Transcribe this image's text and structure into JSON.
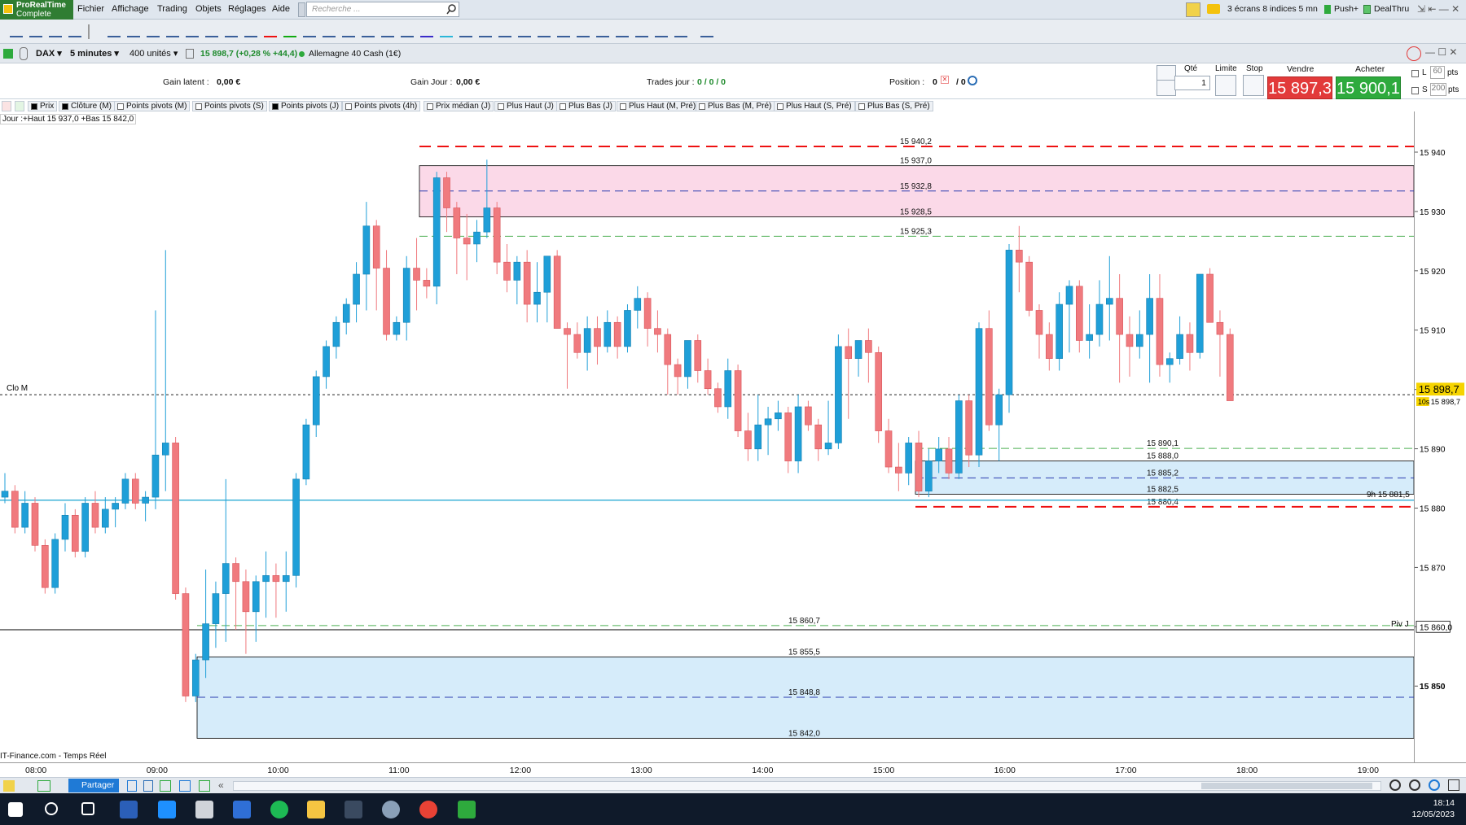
{
  "app": {
    "brand": "ProRealTime",
    "edition": "Complete"
  },
  "menu": [
    "Fichier",
    "Affichage",
    "Trading",
    "Objets",
    "Réglages",
    "Aide"
  ],
  "search": {
    "placeholder": "Recherche ..."
  },
  "topright": {
    "layout": "3 écrans 8 indices 5 mn",
    "push": "Push+",
    "dealthru": "DealThru"
  },
  "instrument": {
    "name": "DAX",
    "timeframe": "5 minutes",
    "units": "400 unités",
    "quote": "15 898,7 (+0,28 % +44,4)",
    "market": "Allemagne 40 Cash (1€)"
  },
  "order": {
    "gain_latent_label": "Gain latent :",
    "gain_latent": "0,00 €",
    "gain_jour_label": "Gain Jour :",
    "gain_jour": "0,00 €",
    "trades_label": "Trades jour :",
    "trades": "0 / 0 / 0",
    "position_label": "Position :",
    "position": "0",
    "position2": "/ 0",
    "qty_label": "Qté",
    "qty": "1",
    "limit_label": "Limite",
    "stop_label": "Stop",
    "sell_label": "Vendre",
    "sell_price": "15 897,3",
    "buy_label": "Acheter",
    "buy_price": "15 900,1",
    "l_label": "L",
    "l_value": "60",
    "s_label": "S",
    "s_value": "200",
    "pts": "pts"
  },
  "legend": [
    {
      "label": "Prix",
      "on": true
    },
    {
      "label": "Clôture (M)",
      "on": true
    },
    {
      "label": "Points pivots (M)",
      "on": false
    },
    {
      "label": "Points pivots (S)",
      "on": false
    },
    {
      "label": "Points pivots (J)",
      "on": true
    },
    {
      "label": "Points pivots (4h)",
      "on": false
    },
    {
      "label": "Prix médian (J)",
      "on": false
    },
    {
      "label": "Plus Haut (J)",
      "on": false
    },
    {
      "label": "Plus Bas (J)",
      "on": false
    },
    {
      "label": "Plus Haut (M, Pré)",
      "on": false
    },
    {
      "label": "Plus Bas (M, Pré)",
      "on": false
    },
    {
      "label": "Plus Haut (S, Pré)",
      "on": false
    },
    {
      "label": "Plus Bas (S, Pré)",
      "on": false
    }
  ],
  "chart_info": "Jour :+Haut 15 937,0 +Bas 15 842,0",
  "source": "IT-Finance.com - Temps Réel",
  "chart_data": {
    "type": "candlestick",
    "ylim": [
      15838,
      15946
    ],
    "yticks": [
      "15 940",
      "15 930",
      "15 920",
      "15 910",
      "15 900",
      "15 890",
      "15 880",
      "15 870",
      "15 860,0",
      "15 850"
    ],
    "ytick_values": [
      15940,
      15930,
      15920,
      15910,
      15900,
      15890,
      15880,
      15870,
      15860,
      15850
    ],
    "xticks": [
      "08:00",
      "09:00",
      "10:00",
      "11:00",
      "12:00",
      "13:00",
      "14:00",
      "15:00",
      "16:00",
      "17:00",
      "18:00",
      "19:00"
    ],
    "last_price": "15 898,7",
    "last_price_value": 15898.7,
    "level_labels": {
      "clo_m": "Clo M",
      "piv_j": "Piv J",
      "r9h": "9h 15 881,5",
      "countdown": "10s",
      "last_small": "15 898,7"
    },
    "levels": [
      {
        "value": 15940.2,
        "label": "15 940,2",
        "style": "red-dash"
      },
      {
        "value": 15937.0,
        "label": "15 937,0",
        "style": "zone-edge"
      },
      {
        "value": 15932.8,
        "label": "15 932,8",
        "style": "blue-dash"
      },
      {
        "value": 15928.5,
        "label": "15 928,5",
        "style": "zone-edge"
      },
      {
        "value": 15925.3,
        "label": "15 925,3",
        "style": "green-dash"
      },
      {
        "value": 15890.1,
        "label": "15 890,1",
        "style": "green-dash"
      },
      {
        "value": 15888.0,
        "label": "15 888,0",
        "style": "zone-edge"
      },
      {
        "value": 15885.2,
        "label": "15 885,2",
        "style": "blue-dash"
      },
      {
        "value": 15882.5,
        "label": "15 882,5",
        "style": "zone-edge"
      },
      {
        "value": 15880.4,
        "label": "15 880,4",
        "style": "red-dash"
      },
      {
        "value": 15860.7,
        "label": "15 860,7",
        "style": "green-dash"
      },
      {
        "value": 15855.5,
        "label": "15 855,5",
        "style": "zone-edge"
      },
      {
        "value": 15848.8,
        "label": "15 848,8",
        "style": "blue-dash"
      },
      {
        "value": 15842.0,
        "label": "15 842,0",
        "style": "zone-edge"
      }
    ],
    "reference_lines": [
      {
        "name": "Clo M",
        "value": 15899.0
      },
      {
        "name": "Piv J",
        "value": 15860.0
      },
      {
        "name": "9h",
        "value": 15881.5
      }
    ],
    "candles": [
      [
        15882,
        15886,
        15881,
        15883
      ],
      [
        15883,
        15884,
        15876,
        15877
      ],
      [
        15877,
        15883,
        15876,
        15881
      ],
      [
        15881,
        15882,
        15873,
        15874
      ],
      [
        15874,
        15875,
        15866,
        15867
      ],
      [
        15867,
        15876,
        15866,
        15875
      ],
      [
        15875,
        15881,
        15873,
        15879
      ],
      [
        15879,
        15880,
        15872,
        15873
      ],
      [
        15873,
        15882,
        15872,
        15881
      ],
      [
        15881,
        15883,
        15876,
        15877
      ],
      [
        15877,
        15882,
        15876,
        15880
      ],
      [
        15880,
        15882,
        15877,
        15881
      ],
      [
        15881,
        15886,
        15880,
        15885
      ],
      [
        15885,
        15886,
        15880,
        15881
      ],
      [
        15881,
        15883,
        15878,
        15882
      ],
      [
        15882,
        15913,
        15880,
        15889
      ],
      [
        15889,
        15923,
        15883,
        15891
      ],
      [
        15891,
        15892,
        15865,
        15866
      ],
      [
        15866,
        15867,
        15848,
        15849
      ],
      [
        15849,
        15856,
        15848,
        15855
      ],
      [
        15855,
        15870,
        15852,
        15861
      ],
      [
        15861,
        15868,
        15857,
        15866
      ],
      [
        15866,
        15885,
        15858,
        15871
      ],
      [
        15871,
        15872,
        15860,
        15868
      ],
      [
        15868,
        15870,
        15856,
        15863
      ],
      [
        15863,
        15869,
        15858,
        15868
      ],
      [
        15868,
        15873,
        15862,
        15869
      ],
      [
        15869,
        15871,
        15862,
        15868
      ],
      [
        15868,
        15873,
        15863,
        15869
      ],
      [
        15869,
        15886,
        15867,
        15885
      ],
      [
        15885,
        15895,
        15884,
        15894
      ],
      [
        15894,
        15903,
        15892,
        15902
      ],
      [
        15902,
        15908,
        15900,
        15907
      ],
      [
        15907,
        15912,
        15905,
        15911
      ],
      [
        15911,
        15915,
        15909,
        15914
      ],
      [
        15914,
        15921,
        15911,
        15919
      ],
      [
        15919,
        15931,
        15913,
        15927
      ],
      [
        15927,
        15928,
        15913,
        15920
      ],
      [
        15920,
        15923,
        15908,
        15909
      ],
      [
        15909,
        15912,
        15908,
        15911
      ],
      [
        15911,
        15922,
        15908,
        15920
      ],
      [
        15920,
        15925,
        15913,
        15918
      ],
      [
        15918,
        15920,
        15915,
        15917
      ],
      [
        15917,
        15936,
        15914,
        15935
      ],
      [
        15935,
        15936,
        15926,
        15930
      ],
      [
        15930,
        15931,
        15919,
        15925
      ],
      [
        15925,
        15929,
        15918,
        15924
      ],
      [
        15924,
        15928,
        15921,
        15926
      ],
      [
        15926,
        15938,
        15925,
        15930
      ],
      [
        15930,
        15931,
        15919,
        15921
      ],
      [
        15921,
        15924,
        15916,
        15918
      ],
      [
        15918,
        15922,
        15914,
        15921
      ],
      [
        15921,
        15923,
        15911,
        15914
      ],
      [
        15914,
        15921,
        15911,
        15916
      ],
      [
        15916,
        15922,
        15911,
        15922
      ],
      [
        15922,
        15923,
        15910,
        15910
      ],
      [
        15910,
        15911,
        15900,
        15909
      ],
      [
        15909,
        15911,
        15905,
        15906
      ],
      [
        15906,
        15912,
        15903,
        15910
      ],
      [
        15910,
        15912,
        15904,
        15907
      ],
      [
        15907,
        15913,
        15906,
        15911
      ],
      [
        15911,
        15912,
        15905,
        15907
      ],
      [
        15907,
        15914,
        15906,
        15913
      ],
      [
        15913,
        15917,
        15910,
        15915
      ],
      [
        15915,
        15916,
        15907,
        15910
      ],
      [
        15910,
        15913,
        15906,
        15909
      ],
      [
        15909,
        15910,
        15899,
        15904
      ],
      [
        15904,
        15905,
        15899,
        15902
      ],
      [
        15902,
        15908,
        15900,
        15908
      ],
      [
        15908,
        15909,
        15901,
        15903
      ],
      [
        15903,
        15905,
        15899,
        15900
      ],
      [
        15900,
        15901,
        15896,
        15897
      ],
      [
        15897,
        15905,
        15895,
        15903
      ],
      [
        15903,
        15904,
        15892,
        15893
      ],
      [
        15893,
        15896,
        15888,
        15890
      ],
      [
        15890,
        15899,
        15888,
        15894
      ],
      [
        15894,
        15897,
        15889,
        15895
      ],
      [
        15895,
        15898,
        15893,
        15896
      ],
      [
        15896,
        15897,
        15886,
        15888
      ],
      [
        15888,
        15899,
        15886,
        15897
      ],
      [
        15897,
        15898,
        15893,
        15894
      ],
      [
        15894,
        15895,
        15888,
        15890
      ],
      [
        15890,
        15898,
        15889,
        15891
      ],
      [
        15891,
        15909,
        15890,
        15907
      ],
      [
        15907,
        15910,
        15895,
        15905
      ],
      [
        15905,
        15908,
        15902,
        15908
      ],
      [
        15908,
        15910,
        15901,
        15906
      ],
      [
        15906,
        15907,
        15891,
        15893
      ],
      [
        15893,
        15895,
        15886,
        15887
      ],
      [
        15887,
        15891,
        15883,
        15886
      ],
      [
        15886,
        15892,
        15884,
        15891
      ],
      [
        15891,
        15893,
        15882,
        15883
      ],
      [
        15883,
        15890,
        15882,
        15888
      ],
      [
        15888,
        15892,
        15886,
        15890
      ],
      [
        15890,
        15892,
        15885,
        15886
      ],
      [
        15886,
        15899,
        15885,
        15898
      ],
      [
        15898,
        15899,
        15887,
        15889
      ],
      [
        15889,
        15911,
        15887,
        15910
      ],
      [
        15910,
        15913,
        15893,
        15894
      ],
      [
        15894,
        15900,
        15888,
        15899
      ],
      [
        15899,
        15924,
        15896,
        15923
      ],
      [
        15923,
        15927,
        15916,
        15921
      ],
      [
        15921,
        15922,
        15912,
        15913
      ],
      [
        15913,
        15914,
        15905,
        15909
      ],
      [
        15909,
        15911,
        15903,
        15905
      ],
      [
        15905,
        15916,
        15903,
        15914
      ],
      [
        15914,
        15918,
        15906,
        15917
      ],
      [
        15917,
        15918,
        15906,
        15908
      ],
      [
        15908,
        15914,
        15905,
        15909
      ],
      [
        15909,
        15918,
        15907,
        15914
      ],
      [
        15914,
        15922,
        15908,
        15915
      ],
      [
        15915,
        15919,
        15901,
        15909
      ],
      [
        15909,
        15912,
        15902,
        15907
      ],
      [
        15907,
        15913,
        15905,
        15909
      ],
      [
        15909,
        15919,
        15901,
        15915
      ],
      [
        15915,
        15919,
        15902,
        15904
      ],
      [
        15904,
        15906,
        15901,
        15905
      ],
      [
        15905,
        15912,
        15904,
        15909
      ],
      [
        15909,
        15911,
        15903,
        15906
      ],
      [
        15906,
        15919,
        15905,
        15919
      ],
      [
        15919,
        15920,
        15911,
        15911
      ],
      [
        15911,
        15913,
        15902,
        15909
      ],
      [
        15909,
        15910,
        15898,
        15898
      ]
    ]
  }
}
